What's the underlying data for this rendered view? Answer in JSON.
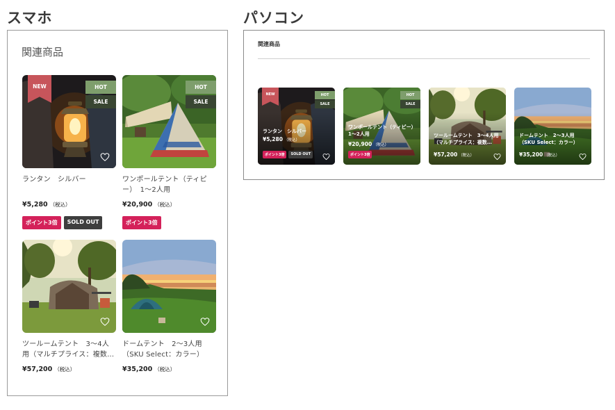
{
  "headings": {
    "mobile": "スマホ",
    "pc": "パソコン"
  },
  "section_title": "関連商品",
  "labels": {
    "tax": "（税込）",
    "new": "NEW",
    "hot": "HOT",
    "sale": "SALE",
    "point": "ポイント3倍",
    "sold_out": "SOLD OUT"
  },
  "products": [
    {
      "name": "ランタン　シルバー",
      "pc_name": "ランタン　シルバー",
      "price": "¥5,280",
      "new": true,
      "hot": true,
      "sale": true,
      "point": true,
      "sold_out": true
    },
    {
      "name": "ワンポールテント（ティピー）　1〜2人用",
      "pc_name": "ワンポールテント（ティピー）　1〜2人用",
      "price": "¥20,900",
      "new": false,
      "hot": true,
      "sale": true,
      "point": true,
      "sold_out": false
    },
    {
      "name": "ツールームテント　3〜4人用（マルチプライス：複数…",
      "pc_name": "ツールームテント　3〜4人用（マルチプライス：複数…",
      "price": "¥57,200",
      "new": false,
      "hot": false,
      "sale": false,
      "point": false,
      "sold_out": false
    },
    {
      "name": "ドームテント　2〜3人用（SKU Select：カラー）",
      "pc_name": "ドームテント　2〜3人用（SKU Select：カラー）",
      "price": "¥35,200",
      "new": false,
      "hot": false,
      "sale": false,
      "point": false,
      "sold_out": false
    }
  ],
  "colors": {
    "new_ribbon": "#c7555b",
    "hot_badge": "#7e9e6c",
    "sale_badge": "#394632",
    "point_tag": "#d4215a",
    "sold_out_tag": "#3e3e3e"
  },
  "icons": {
    "favorite": "heart-outline-icon"
  }
}
